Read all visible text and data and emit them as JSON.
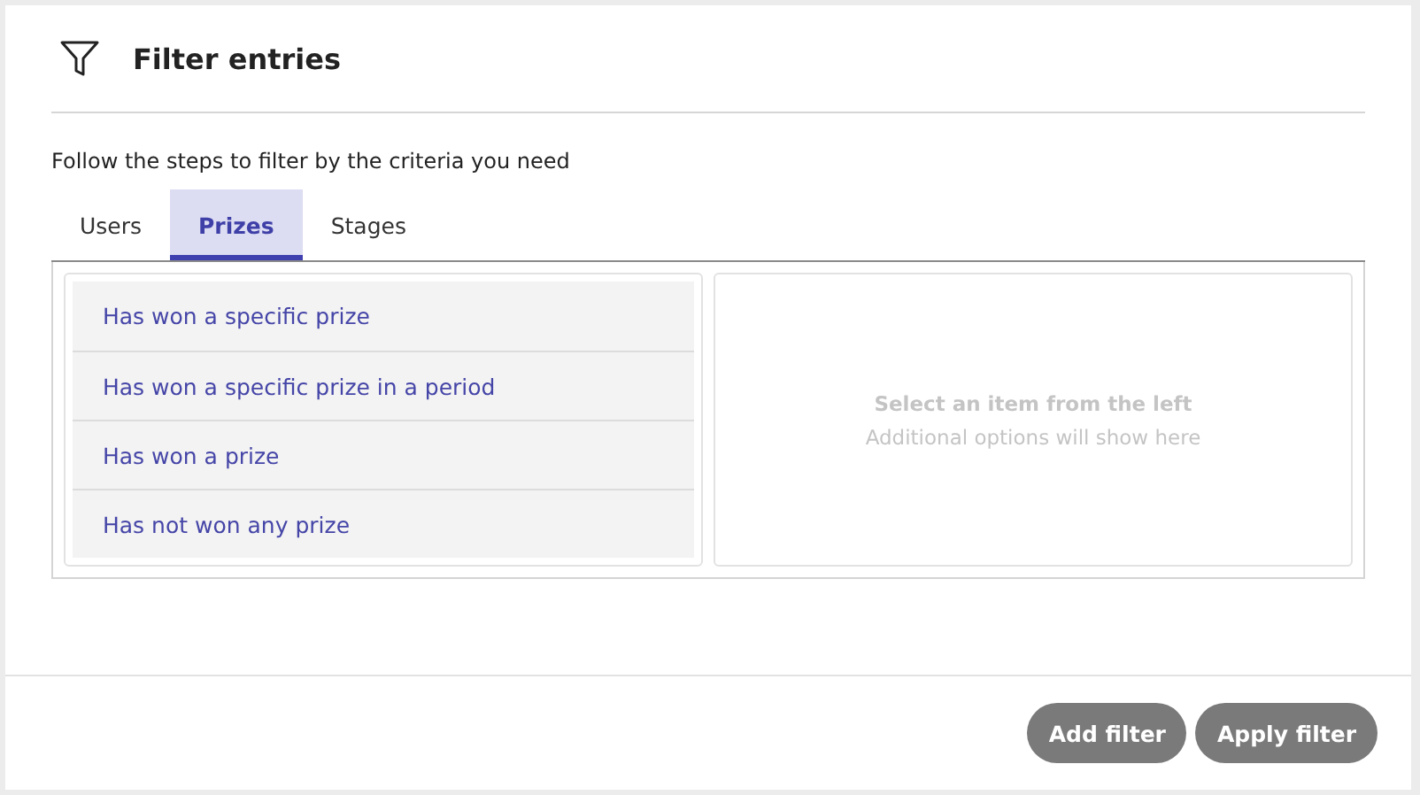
{
  "header": {
    "title": "Filter entries"
  },
  "description": "Follow the steps to filter by the criteria you need",
  "tabs": [
    {
      "label": "Users",
      "selected": false
    },
    {
      "label": "Prizes",
      "selected": true
    },
    {
      "label": "Stages",
      "selected": false
    }
  ],
  "options": [
    {
      "label": "Has won a specific prize"
    },
    {
      "label": "Has won a specific prize in a period"
    },
    {
      "label": "Has won a prize"
    },
    {
      "label": "Has not won any prize"
    }
  ],
  "details": {
    "title": "Select an item from the left",
    "hint": "Additional options will show here"
  },
  "buttons": [
    "Add filter",
    "Apply filter"
  ]
}
